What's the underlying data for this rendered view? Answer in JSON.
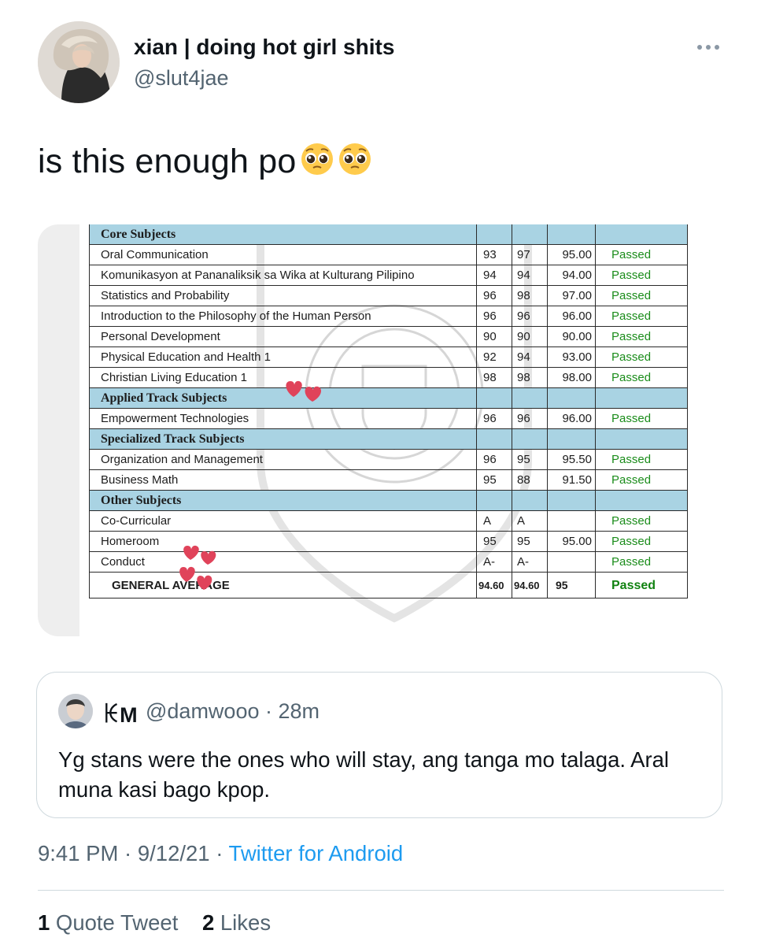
{
  "author": {
    "display_name": "xian | doing hot girl shits",
    "handle": "@slut4jae"
  },
  "tweet": {
    "text": "is this enough po",
    "emoji": [
      "pleading-face",
      "pleading-face"
    ]
  },
  "grade_table": {
    "sections": [
      {
        "title": "Core Subjects",
        "rows": [
          {
            "subject": "Oral Communication",
            "q1": "93",
            "q2": "97",
            "final": "95.00",
            "remarks": "Passed"
          },
          {
            "subject": "Komunikasyon at Pananaliksik sa Wika at Kulturang Pilipino",
            "q1": "94",
            "q2": "94",
            "final": "94.00",
            "remarks": "Passed"
          },
          {
            "subject": "Statistics and Probability",
            "q1": "96",
            "q2": "98",
            "final": "97.00",
            "remarks": "Passed"
          },
          {
            "subject": "Introduction to the Philosophy of the Human Person",
            "q1": "96",
            "q2": "96",
            "final": "96.00",
            "remarks": "Passed"
          },
          {
            "subject": "Personal Development",
            "q1": "90",
            "q2": "90",
            "final": "90.00",
            "remarks": "Passed"
          },
          {
            "subject": "Physical Education and Health 1",
            "q1": "92",
            "q2": "94",
            "final": "93.00",
            "remarks": "Passed"
          },
          {
            "subject": "Christian Living Education 1",
            "q1": "98",
            "q2": "98",
            "final": "98.00",
            "remarks": "Passed"
          }
        ]
      },
      {
        "title": "Applied Track Subjects",
        "rows": [
          {
            "subject": "Empowerment Technologies",
            "q1": "96",
            "q2": "96",
            "final": "96.00",
            "remarks": "Passed"
          }
        ]
      },
      {
        "title": "Specialized Track Subjects",
        "rows": [
          {
            "subject": "Organization and Management",
            "q1": "96",
            "q2": "95",
            "final": "95.50",
            "remarks": "Passed"
          },
          {
            "subject": "Business Math",
            "q1": "95",
            "q2": "88",
            "final": "91.50",
            "remarks": "Passed"
          }
        ]
      },
      {
        "title": "Other Subjects",
        "rows": [
          {
            "subject": "Co-Curricular",
            "q1": "A",
            "q2": "A",
            "final": "",
            "remarks": "Passed"
          },
          {
            "subject": "Homeroom",
            "q1": "95",
            "q2": "95",
            "final": "95.00",
            "remarks": "Passed"
          },
          {
            "subject": "Conduct",
            "q1": "A-",
            "q2": "A-",
            "final": "",
            "remarks": "Passed"
          }
        ]
      }
    ],
    "general_average": {
      "label": "GENERAL AVERAGE",
      "q1": "94.60",
      "q2": "94.60",
      "final": "95",
      "remarks": "Passed"
    }
  },
  "quoted_tweet": {
    "display_name": "ꀘM",
    "handle_time": "@damwooo · 28m",
    "text": "Yg stans were the ones who will stay, ang tanga mo talaga. Aral muna kasi bago kpop."
  },
  "meta": {
    "time_date": "9:41 PM · 9/12/21 · ",
    "source": "Twitter for Android"
  },
  "stats": {
    "quote_count": "1",
    "quote_label": " Quote Tweet",
    "like_count": "2",
    "like_label": " Likes"
  },
  "colors": {
    "link": "#1d9bf0",
    "secondary_text": "#536471",
    "table_header_fill": "#a9d3e3",
    "passed_green": "#1a8c1a",
    "heart": "#e0435a"
  }
}
